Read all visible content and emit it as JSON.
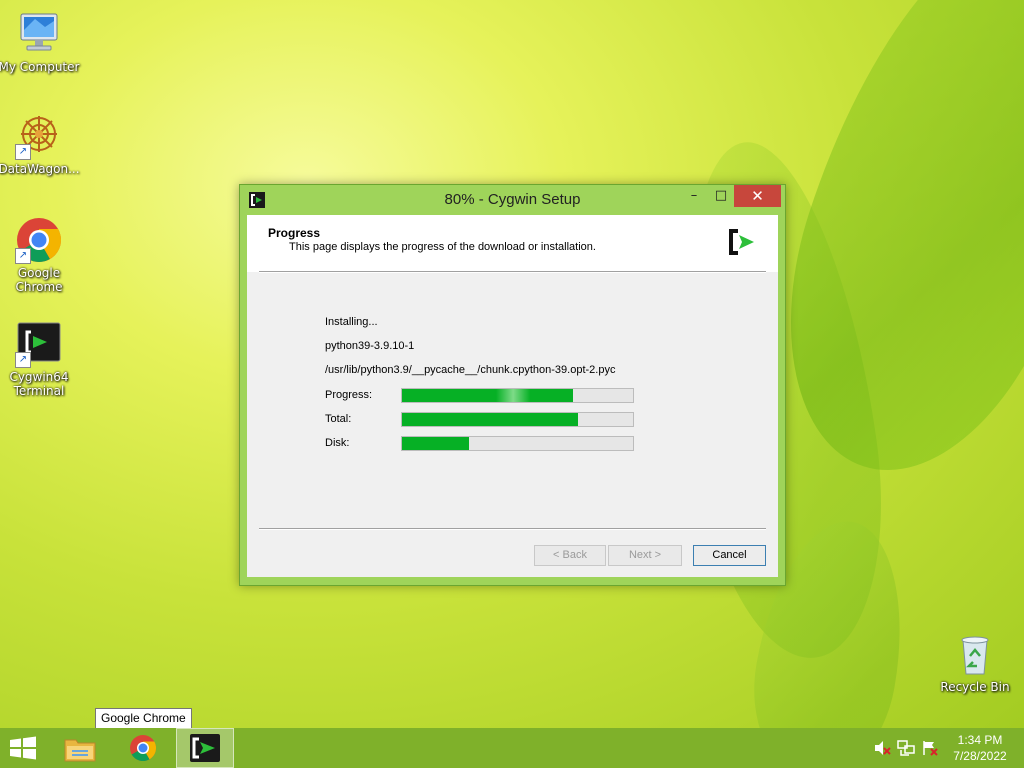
{
  "desktop": {
    "icons": [
      {
        "label": "My Computer"
      },
      {
        "label": "DataWagon..."
      },
      {
        "label": "Google Chrome"
      },
      {
        "label": "Cygwin64 Terminal"
      },
      {
        "label": "Recycle Bin"
      }
    ]
  },
  "window": {
    "title": "80% - Cygwin Setup",
    "header": {
      "title": "Progress",
      "description": "This page displays the progress of the download or installation."
    },
    "status": "Installing...",
    "package": "python39-3.9.10-1",
    "file": "/usr/lib/python3.9/__pycache__/chunk.cpython-39.opt-2.pyc",
    "progress": [
      {
        "label": "Progress:",
        "percent": 74
      },
      {
        "label": "Total:",
        "percent": 76
      },
      {
        "label": "Disk:",
        "percent": 29
      }
    ],
    "buttons": {
      "back": "< Back",
      "next": "Next >",
      "cancel": "Cancel"
    },
    "colors": {
      "progress_fill": "#06b025",
      "titlebar": "#9fd45a",
      "close": "#c7473c"
    }
  },
  "taskbar": {
    "tooltip": "Google Chrome",
    "clock": {
      "time": "1:34 PM",
      "date": "7/28/2022"
    }
  }
}
